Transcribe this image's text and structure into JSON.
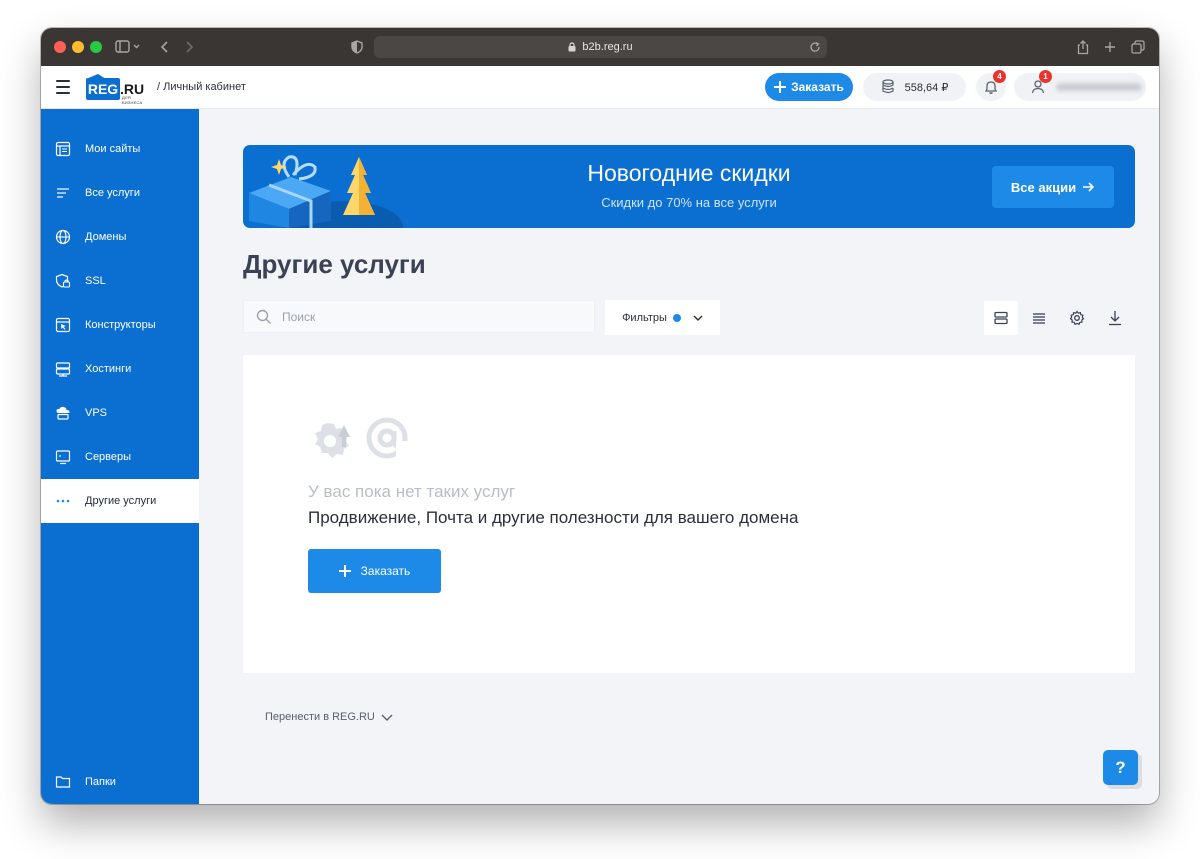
{
  "browser": {
    "url": "b2b.reg.ru"
  },
  "header": {
    "logo_text": "REG",
    "logo_suffix": ".RU",
    "logo_sub": "ДЛЯ БИЗНЕСА",
    "breadcrumb": "/ Личный кабинет",
    "order_label": "Заказать",
    "balance": "558,64 ₽",
    "notifications_count": "4",
    "user_badge": "1"
  },
  "sidebar": {
    "items": [
      {
        "label": "Мои сайты",
        "icon": "sites-icon"
      },
      {
        "label": "Все услуги",
        "icon": "list-icon"
      },
      {
        "label": "Домены",
        "icon": "globe-icon"
      },
      {
        "label": "SSL",
        "icon": "shield-icon"
      },
      {
        "label": "Конструкторы",
        "icon": "constructor-icon"
      },
      {
        "label": "Хостинги",
        "icon": "hosting-icon"
      },
      {
        "label": "VPS",
        "icon": "cloud-server-icon"
      },
      {
        "label": "Серверы",
        "icon": "server-icon"
      },
      {
        "label": "Другие услуги",
        "icon": "dots-icon"
      }
    ],
    "folders_label": "Папки",
    "active_index": 8
  },
  "banner": {
    "title": "Новогодние скидки",
    "subtitle": "Скидки до 70% на все услуги",
    "button": "Все акции"
  },
  "main": {
    "title": "Другие услуги",
    "search_placeholder": "Поиск",
    "filters_label": "Фильтры",
    "empty_title": "У вас пока нет таких услуг",
    "empty_desc": "Продвижение, Почта и другие полезности для вашего домена",
    "empty_button": "Заказать",
    "transfer_label": "Перенести в REG.RU"
  },
  "help_label": "?",
  "colors": {
    "brand": "#0a6fd0",
    "accent": "#1d8ae8",
    "badge": "#e8342c"
  }
}
